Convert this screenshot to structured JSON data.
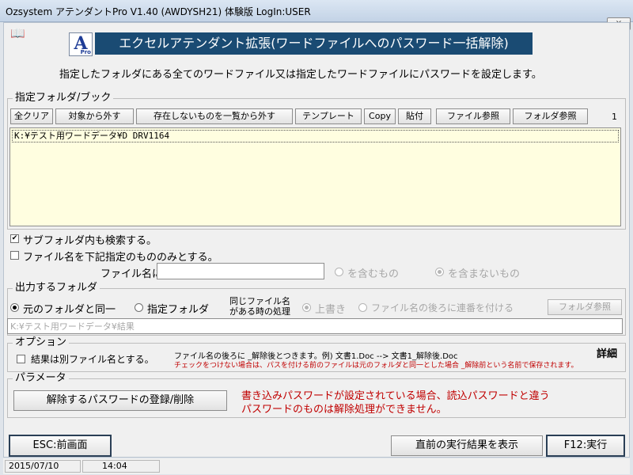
{
  "window": {
    "title": "Ozsystem アテンダントPro V1.40 (AWDYSH21)   体験版 LogIn:USER",
    "close_icon": "×"
  },
  "header": {
    "book_icon": "📖",
    "logo_letter": "A",
    "logo_sub": "Pro",
    "banner": "エクセルアテンダント拡張(ワードファイルへのパスワード一括解除)",
    "description": "指定したフォルダにある全てのワードファイル又は指定したワードファイルにパスワードを設定します。"
  },
  "folder_group": {
    "title": "指定フォルダ/ブック",
    "buttons": {
      "clear_all": "全クリア",
      "exclude_target": "対象から外す",
      "exclude_missing": "存在しないものを一覧から外す",
      "template": "テンプレート",
      "copy": "Copy",
      "paste": "貼付",
      "file_browse": "ファイル参照",
      "folder_browse": "フォルダ参照"
    },
    "count": "1",
    "items": [
      "K:¥テスト用ワードデータ¥D DRV1164"
    ]
  },
  "search_options": {
    "subfolder_label": "サブフォルダ内も検索する。",
    "subfolder_checked": "✔",
    "filename_filter_label": "ファイル名を下記指定のもののみとする。",
    "filename_label": "ファイル名に",
    "filename_value": "",
    "contains_label": "を含むもの",
    "not_contains_label": "を含まないもの"
  },
  "output_group": {
    "title": "出力するフォルダ",
    "same_folder_label": "元のフォルダと同一",
    "specified_folder_label": "指定フォルダ",
    "same_name_label_1": "同じファイル名",
    "same_name_label_2": "がある時の処理",
    "overwrite_label": "上書き",
    "serial_label": "ファイル名の後ろに連番を付ける",
    "folder_browse": "フォルダ参照",
    "path_placeholder": "K:¥テスト用ワードデータ¥結果"
  },
  "options_group": {
    "title": "オプション",
    "separate_name_label": "結果は別ファイル名とする。",
    "info_line": "ファイル名の後ろに _解除後とつきます。例) 文書1.Doc --> 文書1_解除後.Doc",
    "details_label": "詳細",
    "warning_line": "チェックをつけない場合は、パスを付ける前のファイルは元のフォルダと同一とした場合 _解除前という名前で保存されます。"
  },
  "params_group": {
    "title": "パラメータ",
    "register_button": "解除するパスワードの登録/削除",
    "notice_line_1": "書き込みパスワードが設定されている場合、読込パスワードと違う",
    "notice_line_2": "パスワードのものは解除処理ができません。"
  },
  "footer": {
    "back_button": "ESC:前画面",
    "show_result_button": "直前の実行結果を表示",
    "execute_button": "F12:実行"
  },
  "statusbar": {
    "date": "2015/07/10",
    "time": "14:04"
  }
}
